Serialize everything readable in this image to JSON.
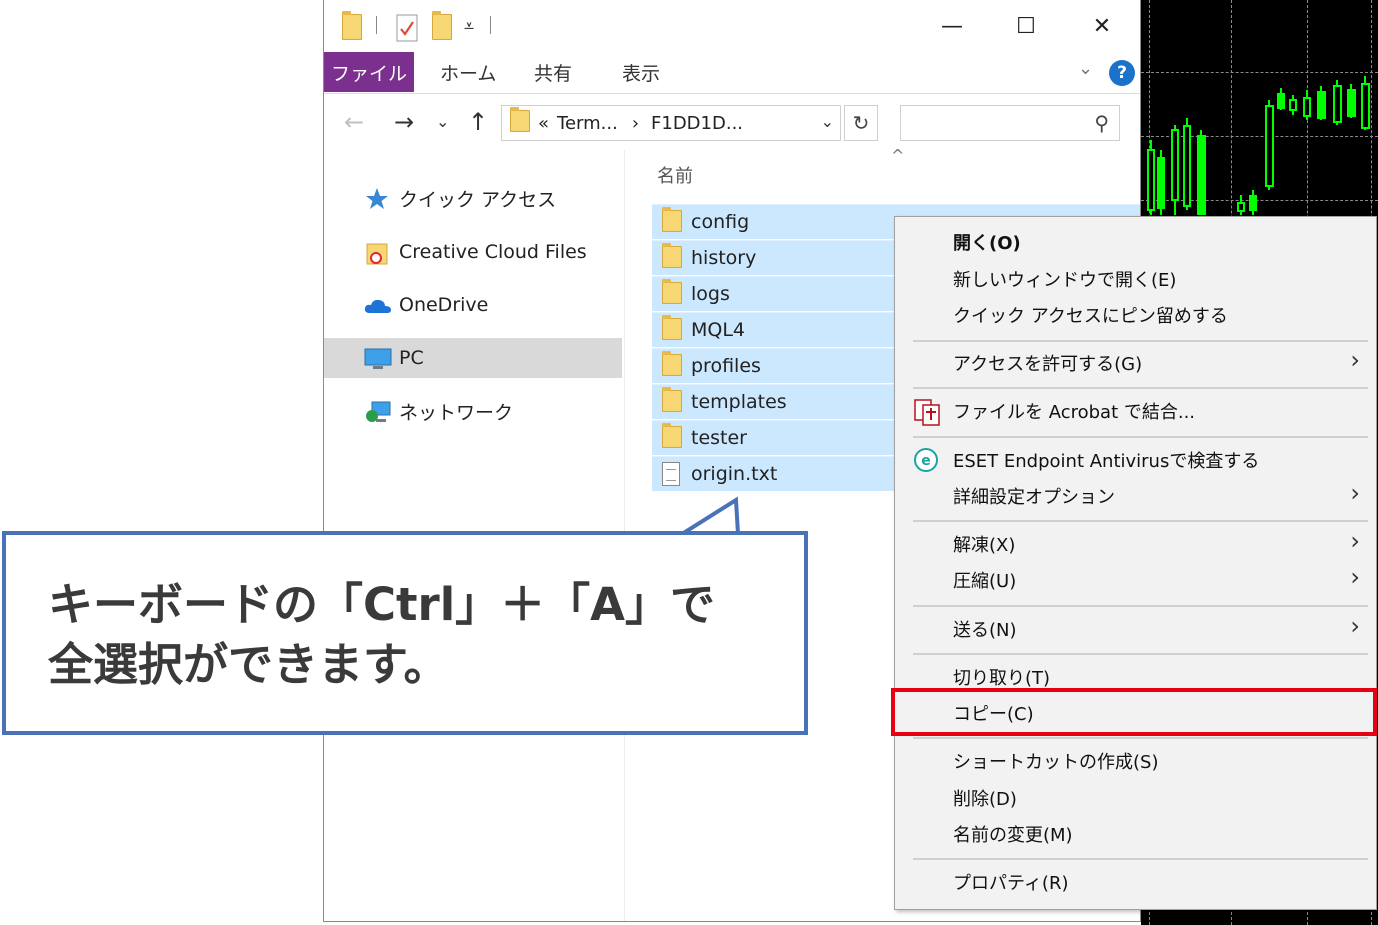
{
  "ribbon": {
    "tabs": [
      "ファイル",
      "ホーム",
      "共有",
      "表示"
    ],
    "help": "?"
  },
  "window_buttons": {
    "minimize": "—",
    "maximize": "☐",
    "close": "✕"
  },
  "address": {
    "prefix": "«",
    "segments": [
      "Term...",
      "F1DD1D..."
    ],
    "separator": "›"
  },
  "nav": {
    "items": [
      {
        "label": "クイック アクセス",
        "icon": "star-pin-icon"
      },
      {
        "label": "Creative Cloud Files",
        "icon": "creative-cloud-folder-icon"
      },
      {
        "label": "OneDrive",
        "icon": "onedrive-cloud-icon"
      },
      {
        "label": "PC",
        "icon": "pc-monitor-icon",
        "selected": true
      },
      {
        "label": "ネットワーク",
        "icon": "network-icon"
      }
    ]
  },
  "files": {
    "column_name": "名前",
    "items": [
      {
        "name": "config",
        "type": "folder"
      },
      {
        "name": "history",
        "type": "folder"
      },
      {
        "name": "logs",
        "type": "folder"
      },
      {
        "name": "MQL4",
        "type": "folder"
      },
      {
        "name": "profiles",
        "type": "folder"
      },
      {
        "name": "templates",
        "type": "folder"
      },
      {
        "name": "tester",
        "type": "folder"
      },
      {
        "name": "origin.txt",
        "type": "text-file"
      }
    ]
  },
  "context_menu": {
    "items": [
      {
        "label": "開く(O)",
        "bold": true
      },
      {
        "label": "新しいウィンドウで開く(E)"
      },
      {
        "label": "クイック アクセスにピン留めする"
      },
      {
        "label": "アクセスを許可する(G)",
        "submenu": true
      },
      {
        "label": "ファイルを Acrobat で結合...",
        "icon": "acrobat-combine-icon"
      },
      {
        "label": "ESET Endpoint Antivirusで検査する",
        "icon": "eset-icon"
      },
      {
        "label": "詳細設定オプション",
        "submenu": true
      },
      {
        "label": "解凍(X)",
        "submenu": true
      },
      {
        "label": "圧縮(U)",
        "submenu": true
      },
      {
        "label": "送る(N)",
        "submenu": true
      },
      {
        "label": "切り取り(T)"
      },
      {
        "label": "コピー(C)",
        "highlighted": true
      },
      {
        "label": "ショートカットの作成(S)"
      },
      {
        "label": "削除(D)"
      },
      {
        "label": "名前の変更(M)"
      },
      {
        "label": "プロパティ(R)"
      }
    ],
    "submenu_arrow": "›"
  },
  "callout": {
    "line1": "キーボードの「Ctrl」＋「A」で",
    "line2": "全選択ができます。"
  },
  "colors": {
    "file_tab": "#7b2f8e",
    "selection": "#cce8ff",
    "highlight_box": "#e60012",
    "callout_border": "#4a72b8",
    "candle_green": "#00ff00"
  }
}
